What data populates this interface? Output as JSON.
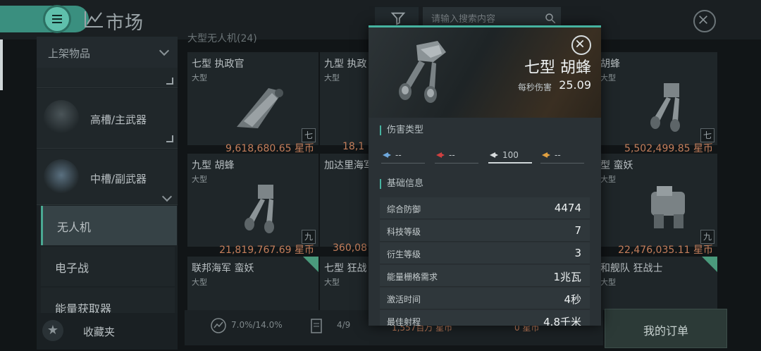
{
  "header": {
    "title": "市场",
    "search_placeholder": "请输入搜索内容"
  },
  "sidebar": {
    "shelf_label": "上架物品",
    "slots": [
      {
        "label": "高槽/主武器"
      },
      {
        "label": "中槽/副武器"
      }
    ],
    "subcategories": [
      "无人机",
      "电子战",
      "能量获取器"
    ],
    "favorites_label": "收藏夹"
  },
  "grid": {
    "header": "大型无人机(24)",
    "cards": [
      {
        "name": "七型 执政官",
        "size": "大型",
        "badge": "七"
      },
      {
        "name": "九型 执政",
        "size": "大型",
        "badge": ""
      },
      {
        "name": "胡蜂",
        "size": "大型",
        "badge": "七"
      },
      {
        "name": "九型 胡蜂",
        "size": "大型",
        "badge": "九"
      },
      {
        "name": "加达里海军",
        "size": "",
        "badge": ""
      },
      {
        "name": "型 蛮妖",
        "size": "大型",
        "badge": "九"
      },
      {
        "name": "联邦海军 蛮妖",
        "size": "大型",
        "badge": ""
      },
      {
        "name": "七型 狂战",
        "size": "大型",
        "badge": ""
      },
      {
        "name": "和舰队 狂战士",
        "size": "大型",
        "badge": ""
      }
    ],
    "prices": [
      "9,618,680.65 星币",
      "18,1",
      "5,502,499.85 星币",
      "21,819,767.69 星币",
      "360,08",
      "22,476,035.11 星币"
    ]
  },
  "bottom": {
    "rate": "7.0%/14.0%",
    "page": "4/9",
    "money": "1,557百万 星币",
    "orders": "0 星币",
    "my_orders": "我的订单"
  },
  "detail": {
    "name": "七型 胡蜂",
    "dps_label": "每秒伤害",
    "dps_value": "25.09",
    "damage_section": "伤害类型",
    "damage": [
      {
        "type": "em",
        "value": "--",
        "color": "#6fa8dc"
      },
      {
        "type": "thermal",
        "value": "--",
        "color": "#d04040"
      },
      {
        "type": "kinetic",
        "value": "100",
        "color": "#d8dcde"
      },
      {
        "type": "explosive",
        "value": "--",
        "color": "#e0a040"
      }
    ],
    "info_section": "基础信息",
    "info": [
      {
        "k": "综合防御",
        "v": "4474"
      },
      {
        "k": "科技等级",
        "v": "7"
      },
      {
        "k": "衍生等级",
        "v": "3"
      },
      {
        "k": "能量栅格需求",
        "v": "1兆瓦"
      },
      {
        "k": "激活时间",
        "v": "4秒"
      },
      {
        "k": "最佳射程",
        "v": "4.8千米"
      }
    ]
  },
  "icons": [
    "menu-icon",
    "chart-icon",
    "filter-icon",
    "search-icon",
    "close-icon",
    "star-icon",
    "chevron-down-icon"
  ]
}
